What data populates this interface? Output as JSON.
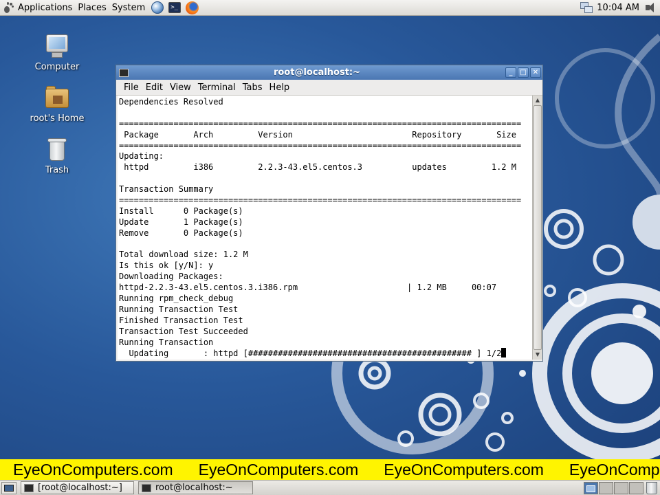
{
  "top_panel": {
    "menus": [
      "Applications",
      "Places",
      "System"
    ],
    "clock": "10:04 AM"
  },
  "desktop": {
    "icons": [
      {
        "label": "Computer",
        "icon": "computer-icon"
      },
      {
        "label": "root's Home",
        "icon": "home-folder-icon"
      },
      {
        "label": "Trash",
        "icon": "trash-icon"
      }
    ]
  },
  "window": {
    "title": "root@localhost:~",
    "menu": [
      "File",
      "Edit",
      "View",
      "Terminal",
      "Tabs",
      "Help"
    ],
    "terminal_lines": [
      "Dependencies Resolved",
      "",
      "=================================================================================",
      " Package       Arch         Version                        Repository       Size",
      "=================================================================================",
      "Updating:",
      " httpd         i386         2.2.3-43.el5.centos.3          updates         1.2 M",
      "",
      "Transaction Summary",
      "=================================================================================",
      "Install      0 Package(s)",
      "Update       1 Package(s)",
      "Remove       0 Package(s)",
      "",
      "Total download size: 1.2 M",
      "Is this ok [y/N]: y",
      "Downloading Packages:",
      "httpd-2.2.3-43.el5.centos.3.i386.rpm                      | 1.2 MB     00:07",
      "Running rpm_check_debug",
      "Running Transaction Test",
      "Finished Transaction Test",
      "Transaction Test Succeeded",
      "Running Transaction",
      "  Updating       : httpd [############################################# ] 1/2"
    ]
  },
  "watermark": {
    "text": "EyeOnComputers.com",
    "repeats": [
      "EyeOnComputers.com",
      "EyeOnComputers.com",
      "EyeOnComputers.com",
      "EyeOnComputers.com"
    ],
    "background": "#fff400"
  },
  "taskbar": {
    "tasks": [
      {
        "label": "[root@localhost:~]",
        "active": false
      },
      {
        "label": "root@localhost:~",
        "active": true
      }
    ]
  },
  "colors": {
    "desktop_blue": "#28589a",
    "titlebar_blue": "#4a76b2",
    "panel_gray": "#dcdad5"
  }
}
